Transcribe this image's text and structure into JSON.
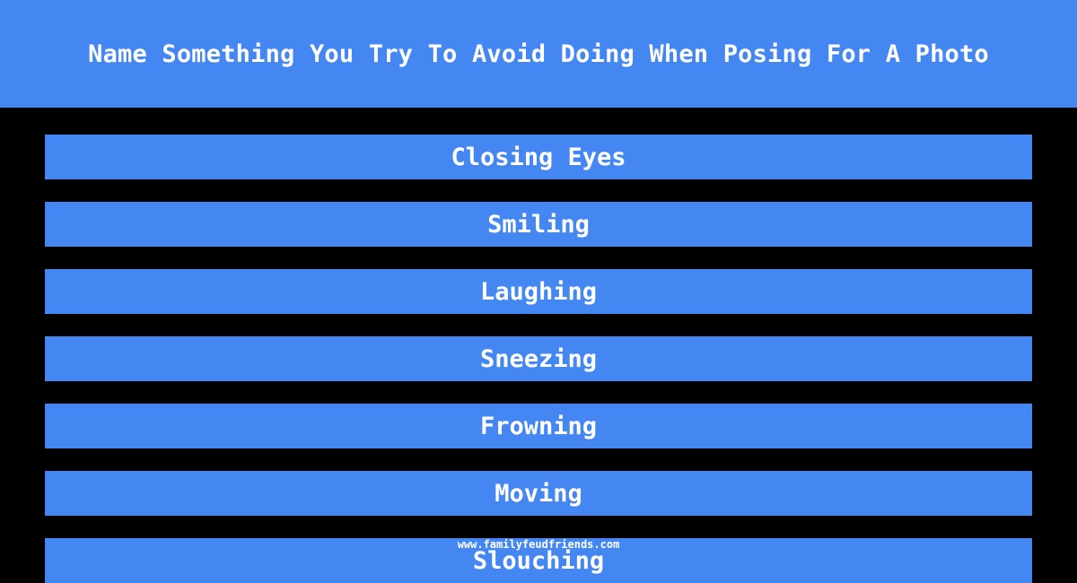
{
  "header": {
    "title": "Name Something You Try To Avoid Doing When Posing For A Photo"
  },
  "answers": [
    "Closing Eyes",
    "Smiling",
    "Laughing",
    "Sneezing",
    "Frowning",
    "Moving",
    "Slouching"
  ],
  "watermark": "www.familyfeudfriends.com",
  "colors": {
    "accent": "#4487F2",
    "background": "#000000",
    "text": "#FFFFFF"
  }
}
